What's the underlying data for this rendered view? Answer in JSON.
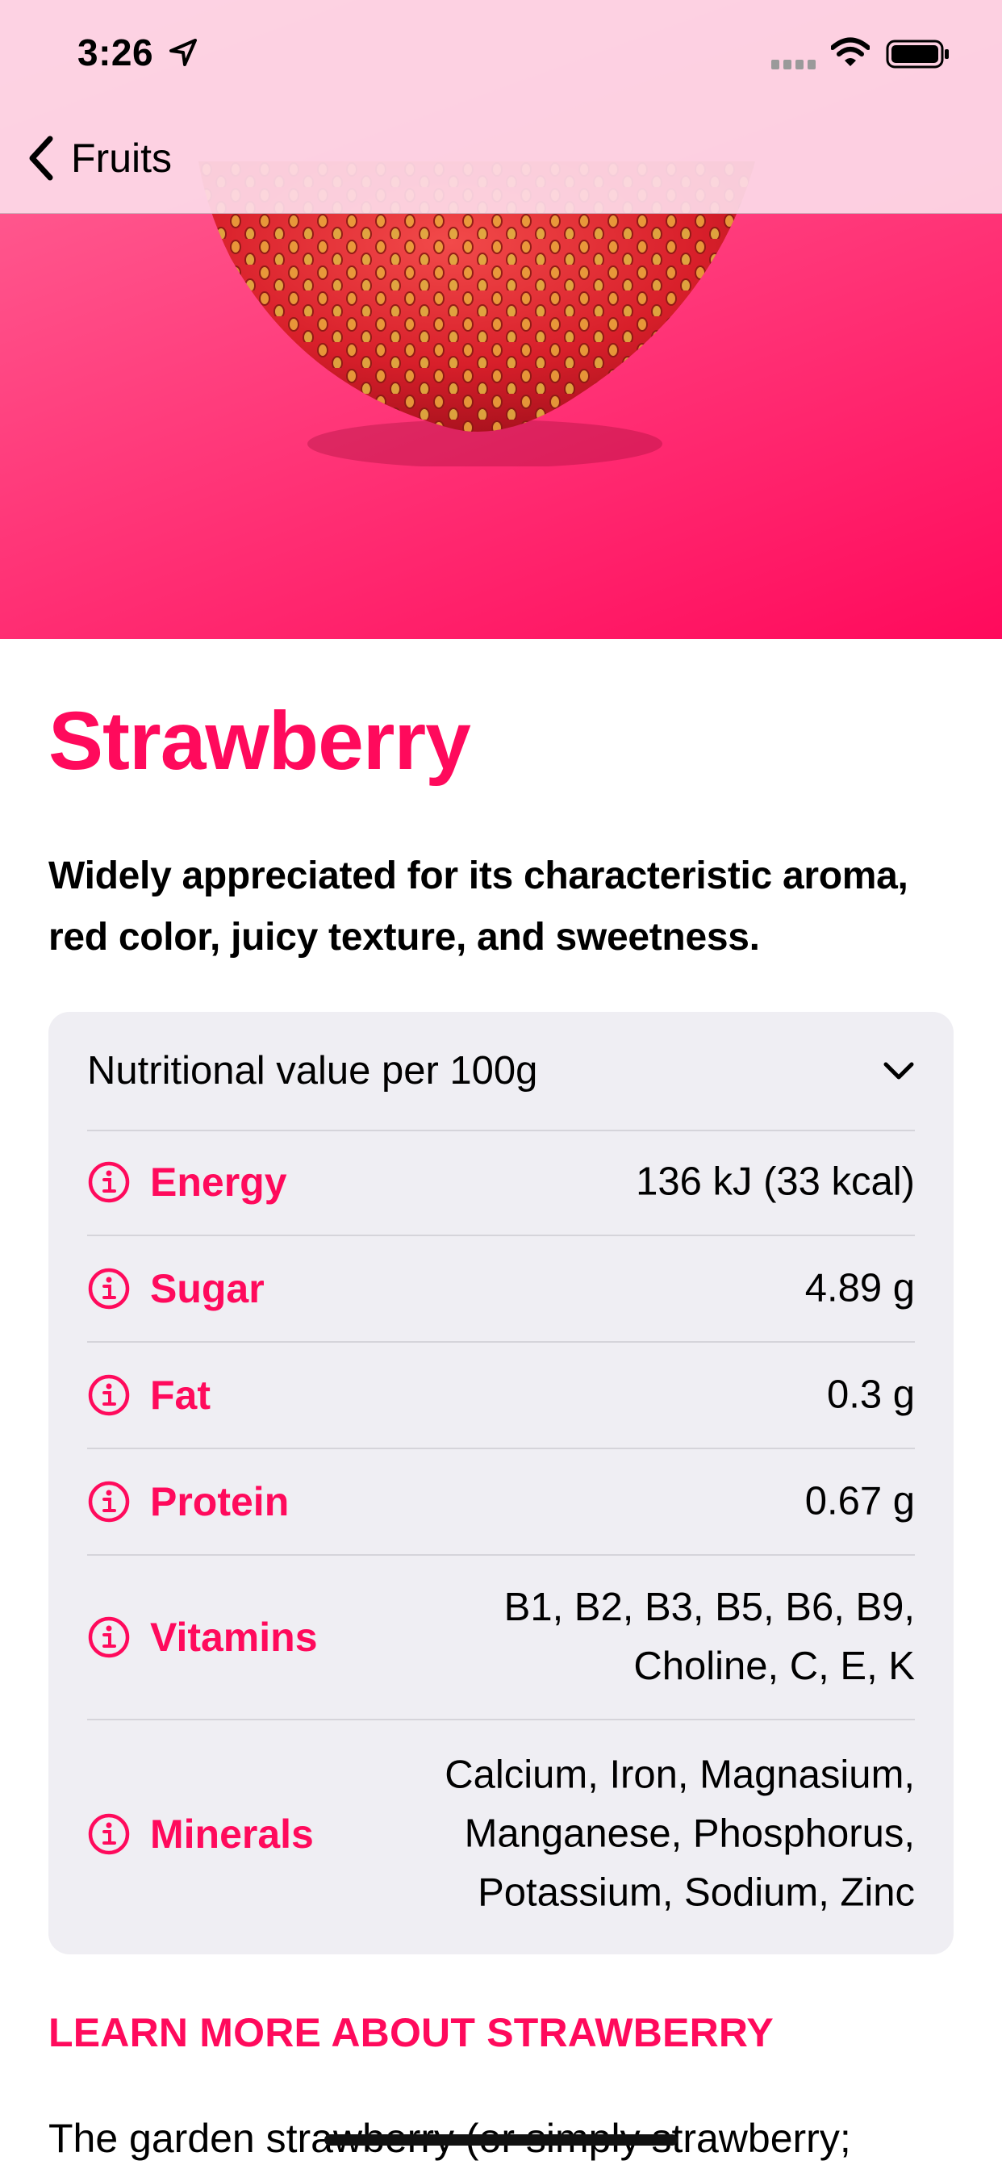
{
  "status_bar": {
    "time": "3:26"
  },
  "nav": {
    "back_label": "Fruits"
  },
  "fruit": {
    "title": "Strawberry",
    "headline": "Widely appreciated for its characteristic aroma,  red color, juicy texture, and sweetness.",
    "accent_color": "#ff0a5c"
  },
  "nutrition": {
    "header": "Nutritional value per 100g",
    "rows": [
      {
        "label": "Energy",
        "value": "136 kJ (33 kcal)"
      },
      {
        "label": "Sugar",
        "value": "4.89 g"
      },
      {
        "label": "Fat",
        "value": "0.3 g"
      },
      {
        "label": "Protein",
        "value": "0.67 g"
      },
      {
        "label": "Vitamins",
        "value": "B1, B2, B3, B5, B6, B9, Choline, C, E, K"
      },
      {
        "label": "Minerals",
        "value": "Calcium, Iron, Magnasium, Manganese, Phosphorus, Potassium, Sodium, Zinc"
      }
    ]
  },
  "learn_more": "LEARN MORE ABOUT STRAWBERRY",
  "description_first_line": "The garden strawberry (or simply strawberry;",
  "icons": {
    "back": "chevron-left-icon",
    "location": "location-arrow-icon",
    "wifi": "wifi-icon",
    "battery": "battery-icon",
    "expand": "chevron-down-icon",
    "info": "info-circle-icon"
  }
}
